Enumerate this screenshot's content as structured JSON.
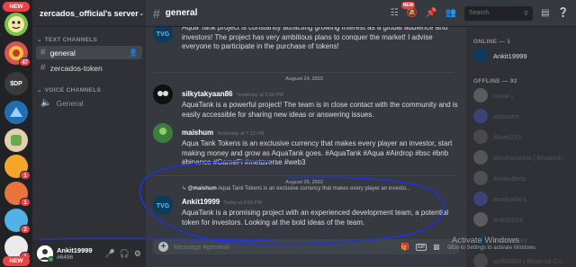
{
  "rail": {
    "new_top": "NEW",
    "new_bottom": "NEW",
    "badges": [
      "47",
      "1",
      "1",
      "2",
      "1"
    ],
    "dp_label": "$DP"
  },
  "sidebar": {
    "server_name": "zercados_official's server",
    "text_category": "TEXT CHANNELS",
    "voice_category": "VOICE CHANNELS",
    "channels": [
      "general",
      "zercados-token"
    ],
    "voice_channels": [
      "General"
    ]
  },
  "user": {
    "name": "Ankit19999",
    "tag": "#6496"
  },
  "header": {
    "channel": "general",
    "search_placeholder": "Search",
    "new_badge": "NEW"
  },
  "messages": [
    {
      "text": "Aqua Tank project is constantly attracting growing interest as a global audience and investors! The project has very ambitious plans to conquer the market! I advise everyone to participate in the purchase of tokens!"
    },
    {
      "divider": "August 24, 2022"
    },
    {
      "author": "silkytakyaan86",
      "time": "Yesterday at 5:06 PM",
      "text": "AquaTank is a powerful project! The team is in close contact with the community and is easily accessible for sharing new ideas or answering issues."
    },
    {
      "author": "maishum",
      "time": "Yesterday at 7:13 PM",
      "text": "Aqua Tank Tokens is an exclusive currency that makes every player an investor, start making money and grow as AquaTank goes. #AquaTank #Aqua #Airdrop #bsc #bnb #binance #GameFi #metaverse #web3"
    },
    {
      "divider": "August 25, 2022"
    },
    {
      "reply_author": "@maishum",
      "reply_text": "Aqua Tank Tokens is an exclusive currency that makes every player an investo...",
      "author": "Ankit19999",
      "time": "Today at 8:58 PM",
      "text": "AquaTank is a promising project with an experienced development team, a potential token for investors. Looking at the bold ideas of the team."
    }
  ],
  "input": {
    "placeholder": "Message #general",
    "gif": "GIF"
  },
  "members": {
    "online_header": "ONLINE — 1",
    "offline_header": "OFFLINE — 92",
    "online": [
      "Ankit19999"
    ],
    "offline": [
      "naval |",
      "alabatee",
      "Alaa6210",
      "aleshacorina | Binance...",
      "Amandeep",
      "analiyafara",
      "Ankit0016",
      "Ankit19999 ...",
      "anf90900 | Binance Cu..."
    ]
  },
  "watermark": {
    "line1": "Activate Windows",
    "line2": "Go to Settings to activate Windows."
  },
  "colors": {
    "accent": "#5865f2",
    "online": "#3ba55d",
    "badge": "#ed4245",
    "annotation": "#1f34d6"
  }
}
